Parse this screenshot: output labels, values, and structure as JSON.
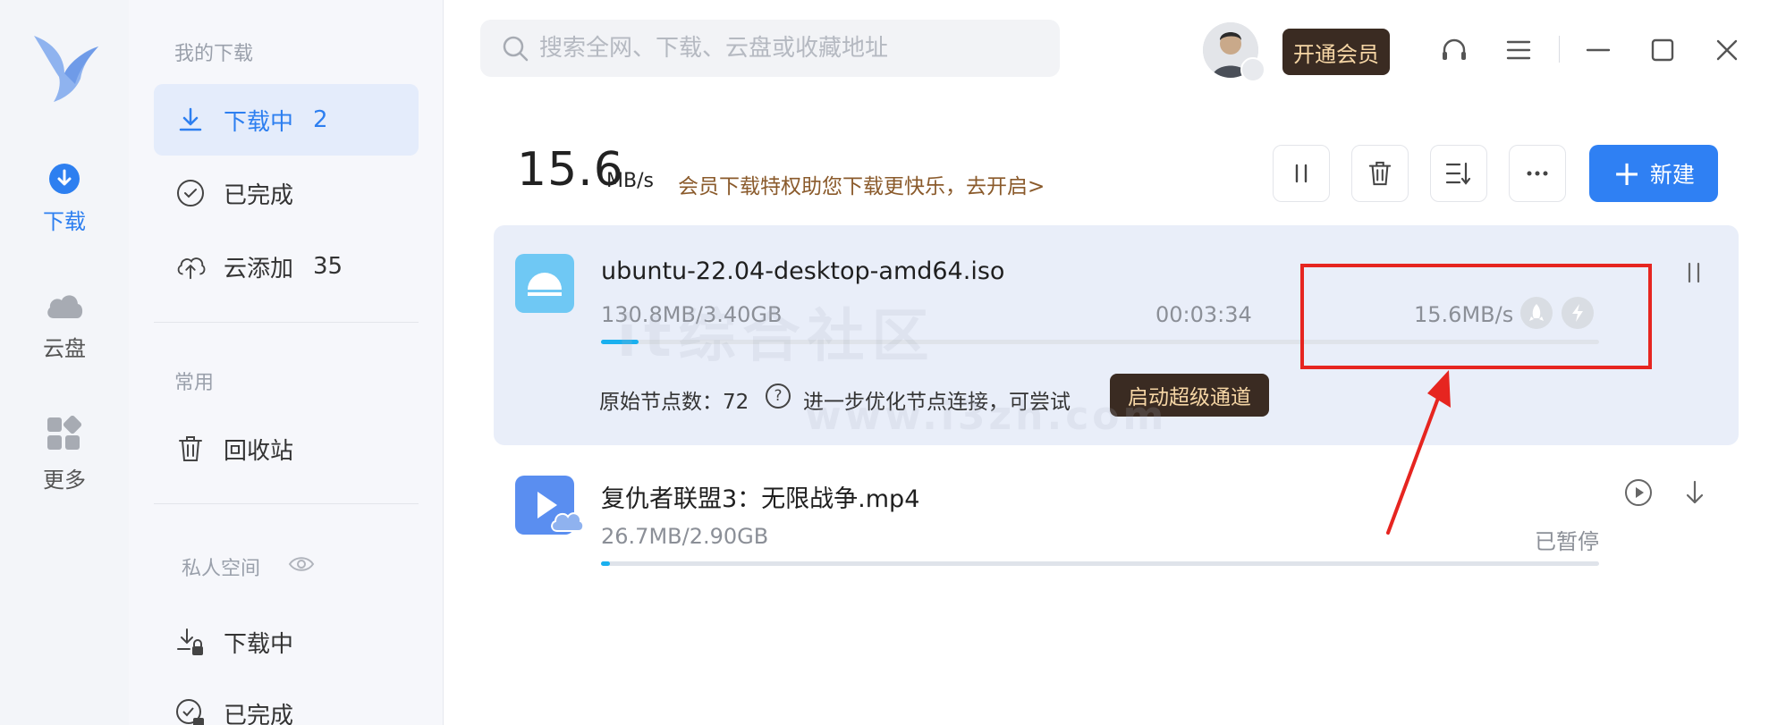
{
  "rail": {
    "logo": "bird-logo",
    "items": [
      {
        "label": "下载",
        "icon": "download-circle-icon",
        "active": true
      },
      {
        "label": "云盘",
        "icon": "cloud-icon",
        "active": false
      },
      {
        "label": "更多",
        "icon": "apps-grid-icon",
        "active": false
      }
    ]
  },
  "nav": {
    "section_my_downloads": "我的下载",
    "downloading": {
      "label": "下载中",
      "count": "2"
    },
    "completed": {
      "label": "已完成"
    },
    "cloud_add": {
      "label": "云添加",
      "count": "35"
    },
    "section_common": "常用",
    "recycle": {
      "label": "回收站"
    },
    "section_private": "私人空间",
    "private_downloading": {
      "label": "下载中"
    },
    "private_completed": {
      "label": "已完成"
    }
  },
  "topbar": {
    "search_placeholder": "搜索全网、下载、云盘或收藏地址",
    "vip_label": "开通会员"
  },
  "toolbar": {
    "speed_value": "15.6",
    "speed_unit": "MB/s",
    "promo_text": "会员下载特权助您下载更快乐，去开启>",
    "new_label": "新建"
  },
  "tasks": [
    {
      "name": "ubuntu-22.04-desktop-amd64.iso",
      "size": "130.8MB/3.40GB",
      "time_left": "00:03:34",
      "speed": "15.6MB/s",
      "progress": 0.038,
      "node_label": "原始节点数：72",
      "tip": "进一步优化节点连接，可尝试",
      "super_button": "启动超级通道"
    },
    {
      "name": "复仇者联盟3：无限战争.mp4",
      "size": "26.7MB/2.90GB",
      "status": "已暂停",
      "progress": 0.009
    }
  ],
  "colors": {
    "accent": "#2f80f3",
    "progress": "#1ab0ef",
    "vip_bg": "#3a2b22",
    "vip_text": "#f6d6a5",
    "annotation": "#e62520"
  },
  "watermark": {
    "line1": "it综合社区",
    "line2": "www.i3zh.com"
  }
}
